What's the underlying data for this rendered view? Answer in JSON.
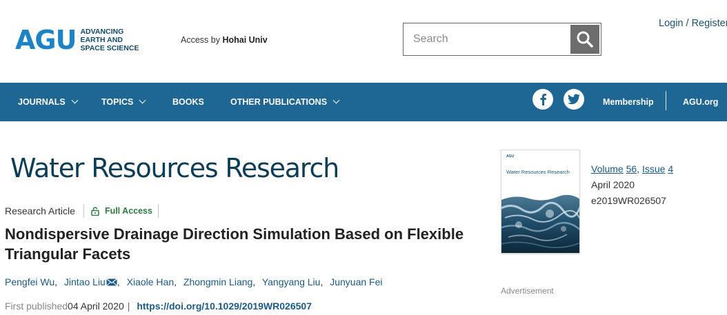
{
  "header": {
    "logo_text": "AGU",
    "logo_tagline": [
      "ADVANCING",
      "EARTH AND",
      "SPACE SCIENCE"
    ],
    "access_prefix": "Access by",
    "access_institution": "Hohai Univ",
    "search_placeholder": "Search",
    "login_text": "Login / Register"
  },
  "nav": {
    "items": [
      {
        "label": "JOURNALS",
        "has_dropdown": true
      },
      {
        "label": "TOPICS",
        "has_dropdown": true
      },
      {
        "label": "BOOKS",
        "has_dropdown": false
      },
      {
        "label": "OTHER PUBLICATIONS",
        "has_dropdown": true
      }
    ],
    "membership": "Membership",
    "agu_org": "AGU.org"
  },
  "journal": {
    "title": "Water Resources Research",
    "cover_logo": "AGU",
    "cover_title": "Water Resources Research"
  },
  "article": {
    "type": "Research Article",
    "access": "Full Access",
    "title": "Nondispersive Drainage Direction Simulation Based on Flexible Triangular Facets",
    "authors": [
      "Pengfei Wu",
      "Jintao Liu",
      "Xiaole Han",
      "Zhongmin Liang",
      "Yangyang Liu",
      "Junyuan Fei"
    ],
    "first_published_label": "First published",
    "first_published_date": "04 April 2020",
    "doi": "https://doi.org/10.1029/2019WR026507"
  },
  "issue": {
    "volume_label": "Volume",
    "volume_number": "56",
    "issue_label": "Issue",
    "issue_number": "4",
    "date": "April 2020",
    "article_id": "e2019WR026507"
  },
  "advertisement_label": "Advertisement",
  "colors": {
    "nav_bg": "#1e6795",
    "brand_blue": "#1c84c6",
    "link": "#1a5a87",
    "full_access_green": "#2a7b3e"
  }
}
